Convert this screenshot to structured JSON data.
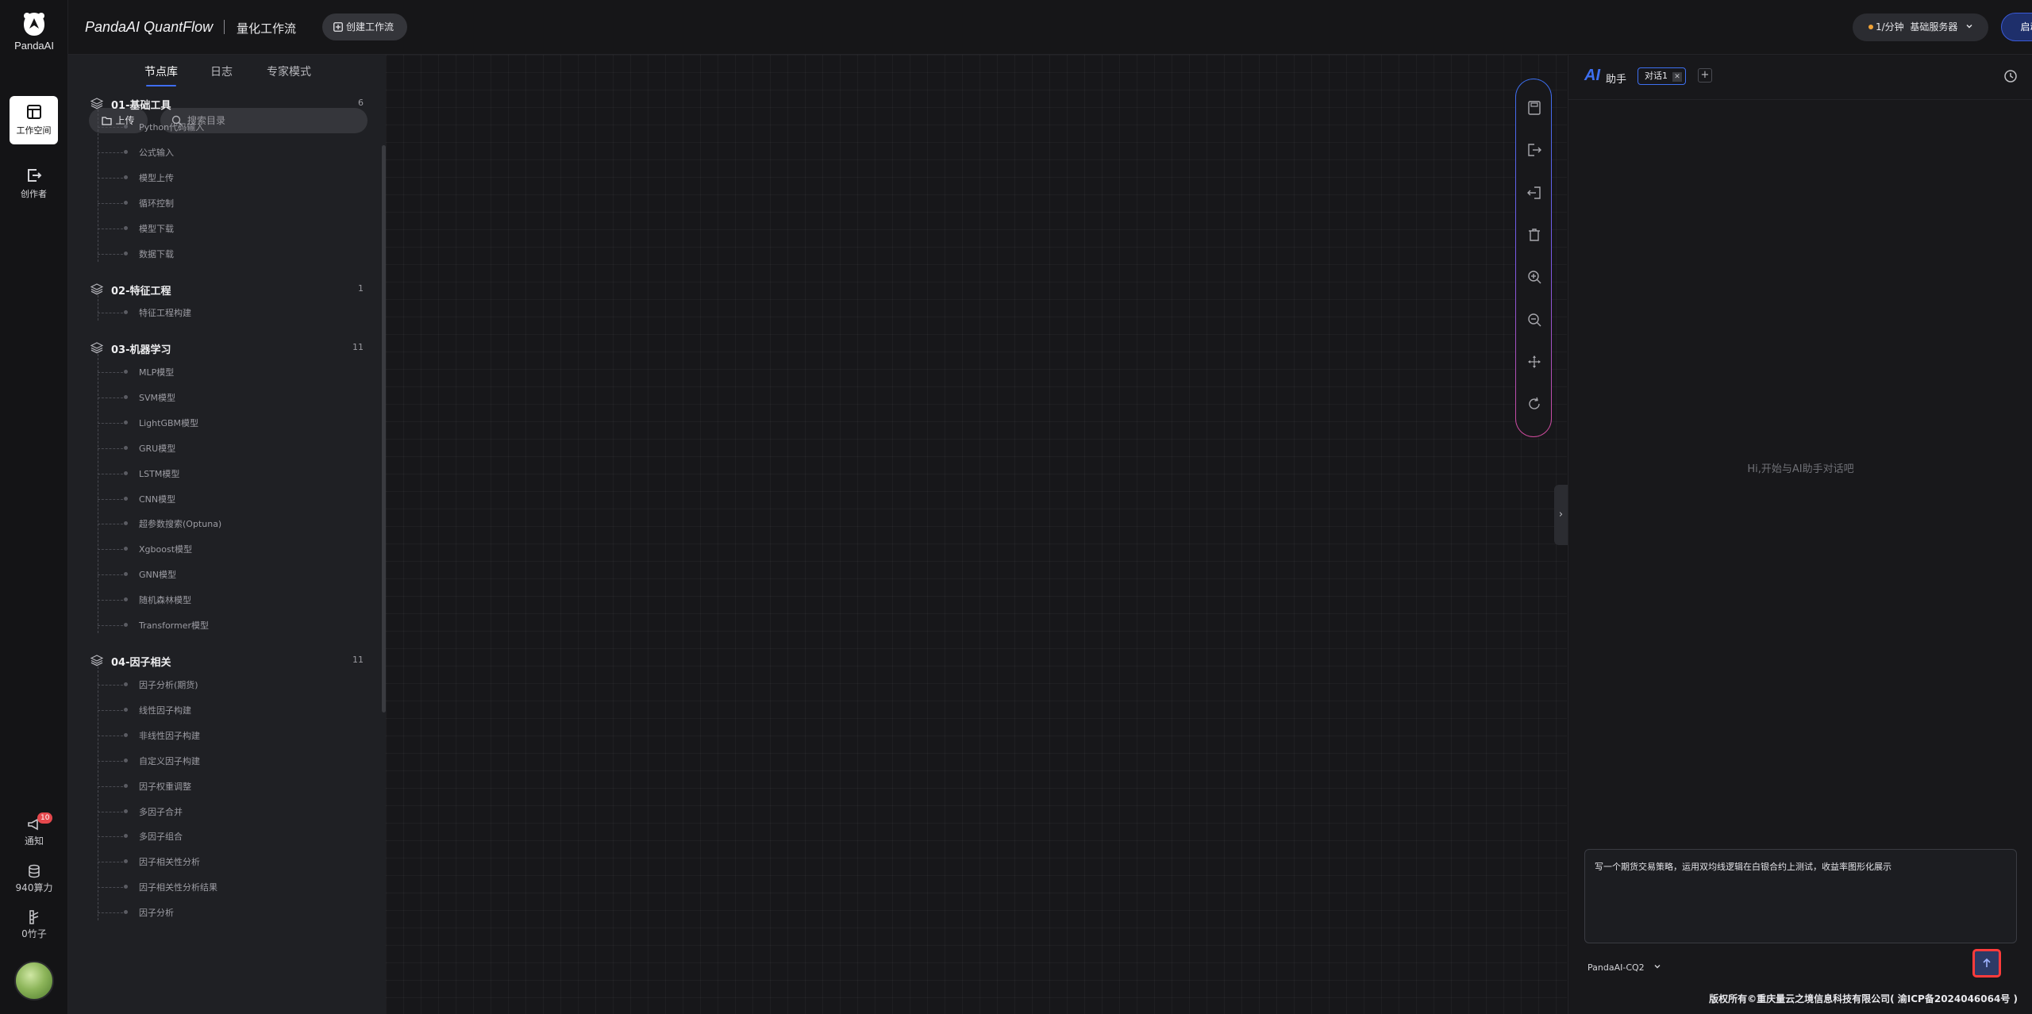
{
  "rail": {
    "logo_text": "PandaAI",
    "workspace_label": "工作空间",
    "creator_label": "创作者",
    "notify_label": "通知",
    "notify_badge": "10",
    "compute_label": "940算力",
    "bamboo_label": "0竹子"
  },
  "header": {
    "brand": "PandaAI QuantFlow",
    "subtitle": "量化工作流",
    "create_label": "创建工作流",
    "server_price": "1/分钟",
    "server_name": "基础服务器",
    "start_label": "启动工作流"
  },
  "library": {
    "tabs": [
      "节点库",
      "日志",
      "专家模式"
    ],
    "upload_label": "上传",
    "search_placeholder": "搜索目录",
    "categories": [
      {
        "name": "01-基础工具",
        "count": "6",
        "items": [
          "Python代码输入",
          "公式输入",
          "模型上传",
          "循环控制",
          "模型下载",
          "数据下载"
        ]
      },
      {
        "name": "02-特征工程",
        "count": "1",
        "items": [
          "特征工程构建"
        ]
      },
      {
        "name": "03-机器学习",
        "count": "11",
        "items": [
          "MLP模型",
          "SVM模型",
          "LightGBM模型",
          "GRU模型",
          "LSTM模型",
          "CNN模型",
          "超参数搜索(Optuna)",
          "Xgboost模型",
          "GNN模型",
          "随机森林模型",
          "Transformer模型"
        ]
      },
      {
        "name": "04-因子相关",
        "count": "11",
        "items": [
          "因子分析(期货)",
          "线性因子构建",
          "非线性因子构建",
          "自定义因子构建",
          "因子权重调整",
          "多因子合并",
          "多因子组合",
          "因子相关性分析",
          "因子相关性分析结果",
          "因子分析"
        ]
      }
    ]
  },
  "toolbar": {
    "icons": [
      "save-icon",
      "export-icon",
      "import-icon",
      "delete-icon",
      "zoom-in-icon",
      "zoom-out-icon",
      "fit-view-icon",
      "refresh-icon"
    ]
  },
  "ai": {
    "logo": "AI",
    "title": "助手",
    "tab_label": "对话1",
    "add_label": "+",
    "empty_hint": "Hi,开始与AI助手对话吧",
    "input_value": "写一个期货交易策略，运用双均线逻辑在白银合约上测试，收益率图形化展示",
    "model": "PandaAI-CQ2"
  },
  "footer": {
    "copyright": "版权所有©重庆量云之境信息科技有限公司( 渝ICP备2024046064号 )"
  },
  "colors": {
    "accent": "#3d6ff0",
    "send_highlight": "#ff3b3b"
  }
}
